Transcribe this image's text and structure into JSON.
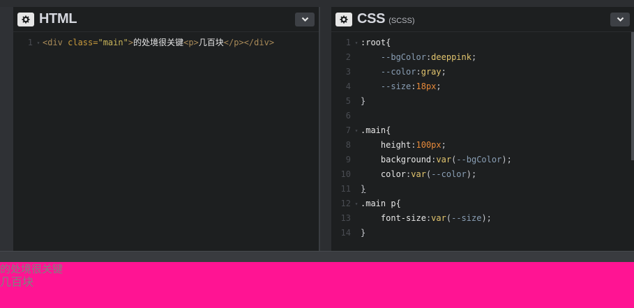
{
  "html_editor": {
    "title": "HTML",
    "lines": [
      {
        "n": "1"
      }
    ],
    "code": {
      "open_div": "<div ",
      "class_attr": "class=",
      "class_val": "\"main\"",
      "close_bracket": ">",
      "text1": "的处境很关键",
      "open_p": "<p>",
      "text2": "几百块",
      "close_p": "</p>",
      "close_div": "</div>"
    }
  },
  "css_editor": {
    "title": "CSS",
    "subtitle": "(SCSS)",
    "line_numbers": [
      "1",
      "2",
      "3",
      "4",
      "5",
      "6",
      "7",
      "8",
      "9",
      "10",
      "11",
      "12",
      "13",
      "14"
    ],
    "l1": ":root{",
    "l2_prop": "--bgColor",
    "l2_val": "deeppink",
    "l3_prop": "--color",
    "l3_val": "gray",
    "l4_prop": "--size",
    "l4_val": "18px",
    "l5": "}",
    "l7": ".main{",
    "l8_prop": "height",
    "l8_val": "100px",
    "l9_prop": "background",
    "l9_fn": "var",
    "l9_arg": "--bgColor",
    "l10_prop": "color",
    "l10_fn": "var",
    "l10_arg": "--color",
    "l11": "}",
    "l12": ".main p{",
    "l13_prop": "font-size",
    "l13_fn": "var",
    "l13_arg": "--size",
    "l14": "}"
  },
  "preview": {
    "main_text": "的处境很关键",
    "p_text": "几百块",
    "bg_color": "#ff1493",
    "text_color": "#808080"
  },
  "icons": {
    "settings": "gear-icon",
    "collapse": "chevron-down-icon"
  }
}
